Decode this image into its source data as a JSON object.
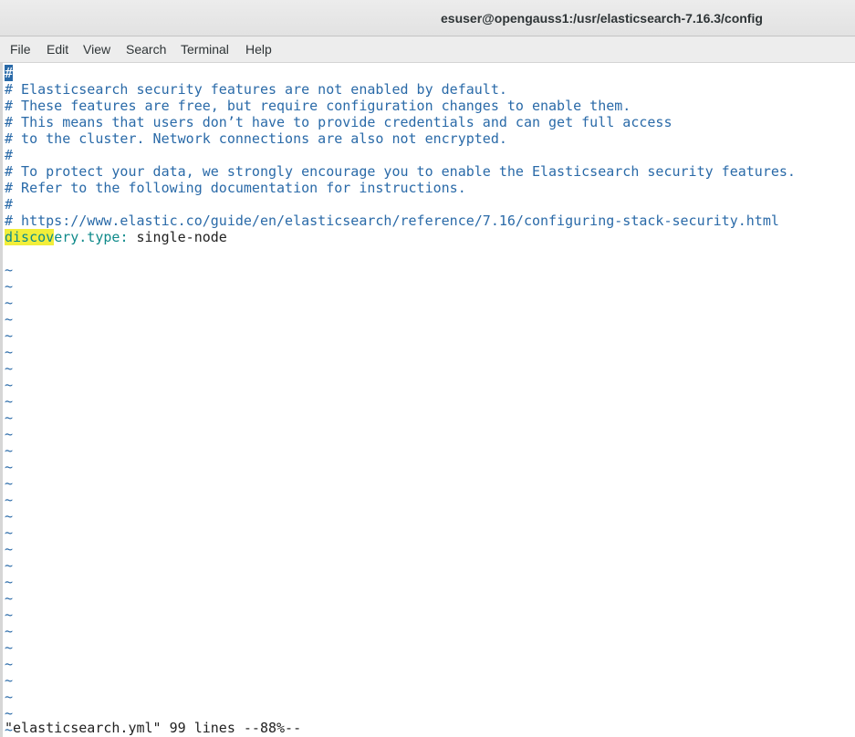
{
  "window": {
    "title": "esuser@opengauss1:/usr/elasticsearch-7.16.3/config"
  },
  "menubar": {
    "items": [
      "File",
      "Edit",
      "View",
      "Search",
      "Terminal",
      "Help"
    ]
  },
  "editor": {
    "cursor_line": "#",
    "comment_lines": [
      "# Elasticsearch security features are not enabled by default.",
      "# These features are free, but require configuration changes to enable them.",
      "# This means that users don’t have to provide credentials and can get full access",
      "# to the cluster. Network connections are also not encrypted.",
      "#",
      "# To protect your data, we strongly encourage you to enable the Elasticsearch security features.",
      "# Refer to the following documentation for instructions.",
      "#",
      "# https://www.elastic.co/guide/en/elasticsearch/reference/7.16/configuring-stack-security.html"
    ],
    "setting": {
      "key_highlighted": "discov",
      "key_rest": "ery.type",
      "separator": ":",
      "value": " single-node"
    },
    "tilde_char": "~",
    "empty_line_count": 29
  },
  "status_line": "\"elasticsearch.yml\" 99 lines --88%--",
  "colors": {
    "comment": "#2a6aa8",
    "key": "#0f8a8a",
    "search_highlight": "#f2ee3a",
    "cursor": "#2a6aa8"
  }
}
